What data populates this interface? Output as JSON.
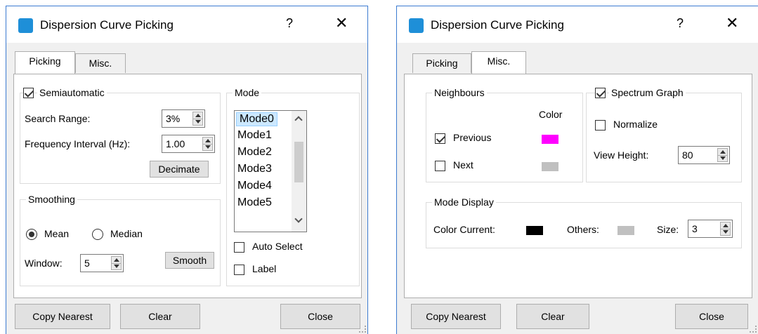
{
  "colors": {
    "titlebar_border": "#3c7bd1",
    "selection": "#cce8ff",
    "app_icon": "#1e8fd8"
  },
  "titlebar": {
    "title": "Dispersion Curve Picking",
    "help_glyph": "?",
    "close_glyph": "✕",
    "icon": "app-icon"
  },
  "tabs": [
    "Picking",
    "Misc."
  ],
  "picking": {
    "semiautomatic_label": "Semiautomatic",
    "semiautomatic_checked": true,
    "search_range_label": "Search Range:",
    "search_range_value": "3%",
    "frequency_interval_label": "Frequency Interval (Hz):",
    "frequency_interval_value": "1.00",
    "decimate_label": "Decimate",
    "smoothing_group_label": "Smoothing",
    "mean_label": "Mean",
    "mean_selected": true,
    "median_label": "Median",
    "window_label": "Window:",
    "window_value": "5",
    "smooth_label": "Smooth",
    "mode_group_label": "Mode",
    "modes": [
      "Mode0",
      "Mode1",
      "Mode2",
      "Mode3",
      "Mode4",
      "Mode5"
    ],
    "selected_mode": "Mode0",
    "auto_select_label": "Auto Select",
    "auto_select_checked": false,
    "label_label": "Label",
    "label_checked": false
  },
  "misc": {
    "neighbours_group_label": "Neighbours",
    "color_header": "Color",
    "previous_label": "Previous",
    "previous_checked": true,
    "previous_color": "#ff00ff",
    "next_label": "Next",
    "next_checked": false,
    "next_color": "#c0c0c0",
    "spectrum_graph_label": "Spectrum Graph",
    "spectrum_graph_checked": true,
    "normalize_label": "Normalize",
    "normalize_checked": false,
    "view_height_label": "View Height:",
    "view_height_value": "80",
    "mode_display_group_label": "Mode Display",
    "color_current_label": "Color Current:",
    "color_current_value": "#000000",
    "others_label": "Others:",
    "others_color": "#c0c0c0",
    "size_label": "Size:",
    "size_value": "3"
  },
  "buttons": {
    "copy_nearest": "Copy Nearest",
    "clear": "Clear",
    "close": "Close"
  }
}
